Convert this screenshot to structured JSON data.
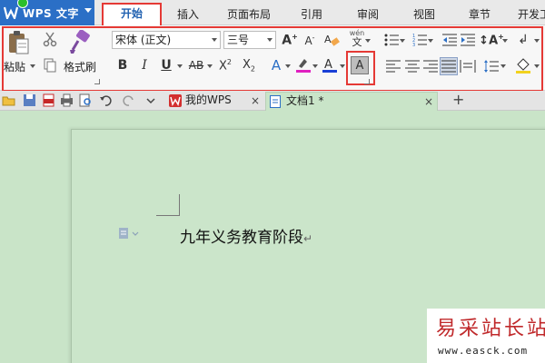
{
  "app": {
    "name": "WPS 文字"
  },
  "menu": {
    "tabs": [
      {
        "label": "开始",
        "active": true
      },
      {
        "label": "插入"
      },
      {
        "label": "页面布局"
      },
      {
        "label": "引用"
      },
      {
        "label": "审阅"
      },
      {
        "label": "视图"
      },
      {
        "label": "章节"
      },
      {
        "label": "开发工"
      }
    ]
  },
  "ribbon": {
    "clipboard": {
      "paste_label": "粘贴",
      "format_painter_label": "格式刷"
    },
    "font": {
      "font_name": "宋体 (正文)",
      "font_size": "三号",
      "wen_char": "文"
    }
  },
  "doc_tabs": [
    {
      "label": "我的WPS"
    },
    {
      "label": "文档1 *",
      "active": true
    }
  ],
  "document": {
    "text": "九年义务教育阶段",
    "para_mark": "↵"
  },
  "watermark": {
    "line1": "易采站长站",
    "line2": "www.easck.com"
  },
  "colors": {
    "highlight_red": "#e53935",
    "app_blue": "#2b6fc6",
    "doc_background": "#c9e4c8"
  }
}
